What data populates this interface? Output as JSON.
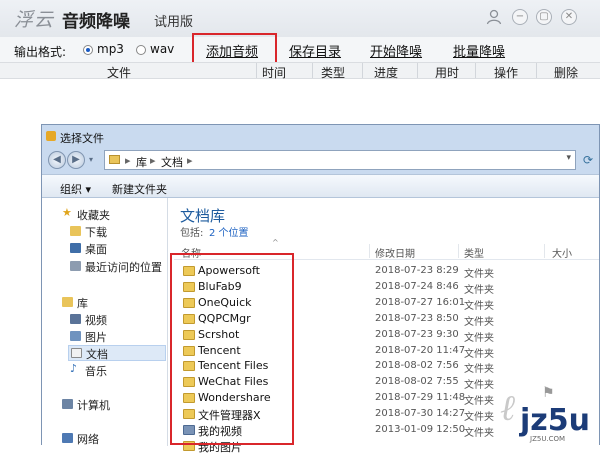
{
  "app": {
    "logo": "浮云",
    "name": "音频降噪",
    "edition": "试用版",
    "controls": {
      "minimize": "−",
      "restore": "▢",
      "close": "✕"
    }
  },
  "toolbar": {
    "format_label": "输出格式:",
    "formats": [
      {
        "label": "mp3",
        "selected": true
      },
      {
        "label": "wav",
        "selected": false
      }
    ],
    "add_audio": "添加音频",
    "save_dir": "保存目录",
    "start": "开始降噪",
    "batch": "批量降噪"
  },
  "table": {
    "columns": [
      "文件",
      "时间",
      "类型",
      "进度",
      "用时",
      "操作",
      "删除"
    ]
  },
  "dialog": {
    "title": "选择文件",
    "address": {
      "parts": [
        "库",
        "文档"
      ]
    },
    "commands": {
      "organize": "组织 ▾",
      "new_folder": "新建文件夹"
    },
    "nav": [
      {
        "label": "收藏夹",
        "icon": "star-icon"
      },
      {
        "label": "下载",
        "icon": "download-folder-icon"
      },
      {
        "label": "桌面",
        "icon": "desktop-icon"
      },
      {
        "label": "最近访问的位置",
        "icon": "recent-places-icon"
      },
      {
        "label": "库",
        "icon": "libraries-icon"
      },
      {
        "label": "视频",
        "icon": "video-library-icon"
      },
      {
        "label": "图片",
        "icon": "picture-library-icon"
      },
      {
        "label": "文档",
        "icon": "document-library-icon",
        "selected": true
      },
      {
        "label": "音乐",
        "icon": "music-library-icon"
      },
      {
        "label": "计算机",
        "icon": "computer-icon"
      },
      {
        "label": "网络",
        "icon": "network-icon"
      }
    ],
    "library": {
      "title": "文档库",
      "include_label": "包括:",
      "locations": "2 个位置"
    },
    "list_columns": [
      "名称",
      "修改日期",
      "类型",
      "大小"
    ],
    "files": [
      {
        "name": "Apowersoft",
        "date": "2018-07-23 8:29",
        "type": "文件夹"
      },
      {
        "name": "BluFab9",
        "date": "2018-07-24 8:46",
        "type": "文件夹"
      },
      {
        "name": "OneQuick",
        "date": "2018-07-27 16:01",
        "type": "文件夹"
      },
      {
        "name": "QQPCMgr",
        "date": "2018-07-23 8:50",
        "type": "文件夹"
      },
      {
        "name": "Scrshot",
        "date": "2018-07-23 9:30",
        "type": "文件夹"
      },
      {
        "name": "Tencent",
        "date": "2018-07-20 11:47",
        "type": "文件夹"
      },
      {
        "name": "Tencent Files",
        "date": "2018-08-02 7:56",
        "type": "文件夹"
      },
      {
        "name": "WeChat Files",
        "date": "2018-08-02 7:55",
        "type": "文件夹"
      },
      {
        "name": "Wondershare",
        "date": "2018-07-29 11:48",
        "type": "文件夹"
      },
      {
        "name": "文件管理器X",
        "date": "2018-07-30 14:27",
        "type": "文件夹"
      },
      {
        "name": "我的视频",
        "date": "2013-01-09 12:50",
        "type": "文件夹"
      },
      {
        "name": "我的图片",
        "date": "",
        "type": ""
      }
    ]
  },
  "watermark": {
    "main": "jz5u",
    "sub": "JZ5U.COM"
  },
  "accent_colors": {
    "highlight": "#d9262b",
    "link": "#1d62c2",
    "library_title": "#1d5b9e"
  }
}
